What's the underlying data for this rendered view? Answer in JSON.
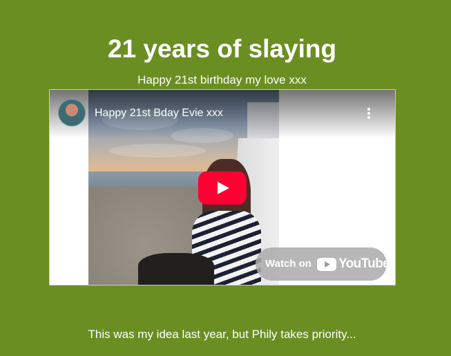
{
  "page": {
    "title": "21 years of slaying",
    "subtitle": "Happy 21st birthday my love xxx",
    "footer": "This was my idea last year, but Phily takes priority..."
  },
  "video": {
    "title": "Happy 21st Bday Evie xxx",
    "watch_on_label": "Watch on",
    "brand_label": "YouTube",
    "icons": {
      "avatar": "channel-avatar",
      "menu": "more-vertical-icon",
      "play": "play-icon",
      "brand": "youtube-logo-icon"
    }
  },
  "colors": {
    "background": "#6b8e23",
    "text": "#ffffff",
    "play_button": "#ff0033",
    "watch_pill": "#aaaaaa"
  }
}
